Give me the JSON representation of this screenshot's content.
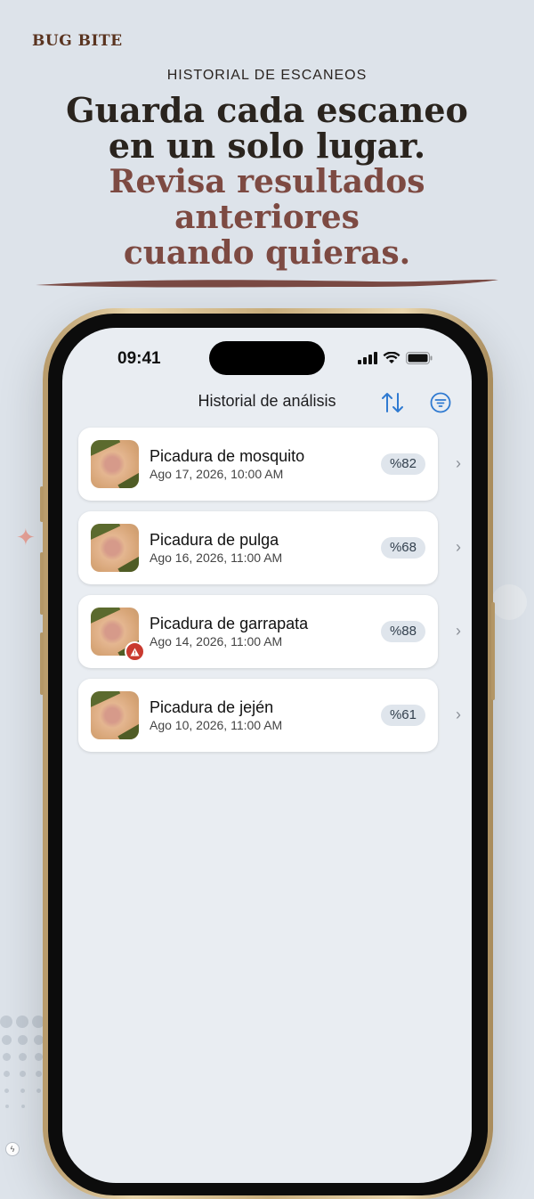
{
  "brand": "BUG BITE",
  "eyebrow": "HISTORIAL DE ESCANEOS",
  "headline": {
    "line1": "Guarda cada escaneo",
    "line2": "en un solo lugar.",
    "line3": "Revisa resultados",
    "line4": "anteriores",
    "line5": "cuando quieras."
  },
  "status": {
    "time": "09:41"
  },
  "nav": {
    "title": "Historial de análisis"
  },
  "colors": {
    "accent": "#2f7ad1",
    "warning": "#c93a2f",
    "headline_accent": "#7d4a42"
  },
  "scans": [
    {
      "title": "Picadura de mosquito",
      "date": "Ago 17, 2026, 10:00 AM",
      "score": "%82",
      "warning": false
    },
    {
      "title": "Picadura de pulga",
      "date": "Ago 16, 2026, 11:00 AM",
      "score": "%68",
      "warning": false
    },
    {
      "title": "Picadura de garrapata",
      "date": "Ago 14, 2026, 11:00 AM",
      "score": "%88",
      "warning": true
    },
    {
      "title": "Picadura de jején",
      "date": "Ago 10, 2026, 11:00 AM",
      "score": "%61",
      "warning": false
    }
  ]
}
